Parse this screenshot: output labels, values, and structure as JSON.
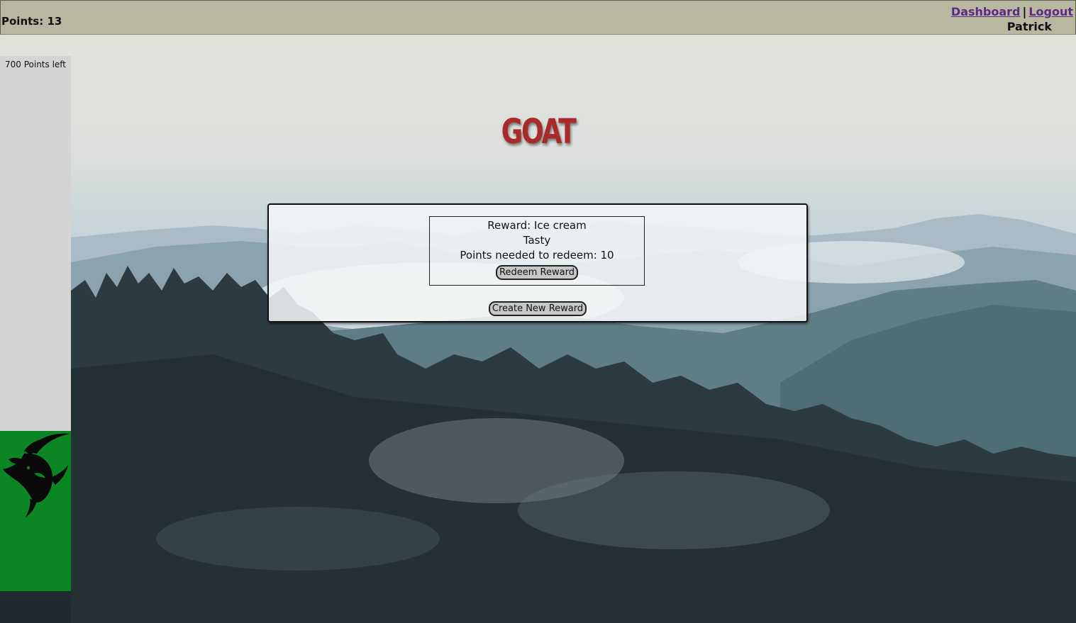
{
  "header": {
    "points_label": "Points: 13",
    "nav_dashboard": "Dashboard",
    "nav_separator": "|",
    "nav_logout": "Logout",
    "username": "Patrick"
  },
  "sidebar": {
    "points_left": "700 Points left"
  },
  "brand": {
    "title": "GOAT",
    "color": "#a82a2a"
  },
  "rewards": [
    {
      "title": "Reward: Ice cream",
      "description": "Tasty",
      "points_needed": "Points needed to redeem: 10",
      "redeem_label": "Redeem Reward"
    }
  ],
  "actions": {
    "create_label": "Create New Reward"
  },
  "colors": {
    "header_bg": "#b8b7a0",
    "sidebar_bg": "#d4d4d4",
    "goat_panel_bg": "#0c8525",
    "link": "#5a2a85"
  },
  "icons": {
    "goat_logo": "goat-head-icon"
  }
}
